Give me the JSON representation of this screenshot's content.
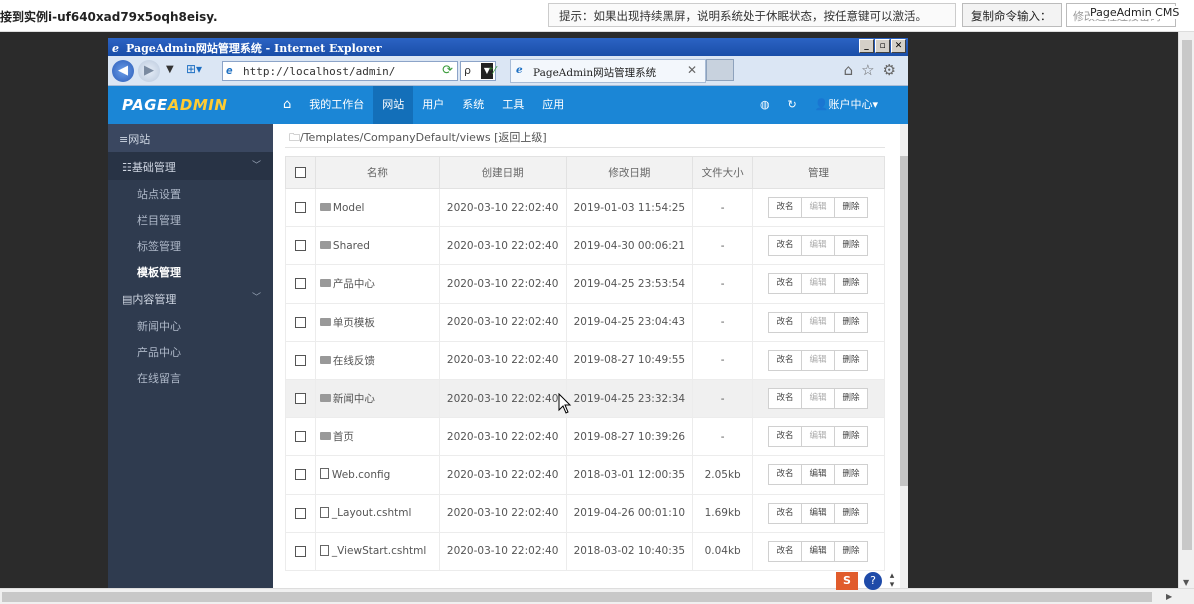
{
  "remote": {
    "title": "接到实例i-uf640xad79x5oqh8eisy.",
    "hint": "提示：如果出现持续黑屏，说明系统处于休眠状态，按任意键可以激活。",
    "copy_label": "复制命令输入：",
    "input_placeholder": "修改远程连接密码",
    "badge": "PageAdmin CMS"
  },
  "ie": {
    "window_title": "PageAdmin网站管理系统 - Internet Explorer",
    "address": "http://localhost/admin/",
    "tab_title": "PageAdmin网站管理系统",
    "search_label": "ρ"
  },
  "app": {
    "logo_main": "PAGE",
    "logo_accent": "ADMIN",
    "nav": [
      "我的工作台",
      "网站",
      "用户",
      "系统",
      "工具",
      "应用"
    ],
    "nav_active_index": 1,
    "account_label": "账户中心"
  },
  "sidebar": {
    "header": "网站",
    "groups": [
      {
        "label": "基础管理",
        "icon": "grid-icon",
        "items": [
          "站点设置",
          "栏目管理",
          "标签管理",
          "模板管理"
        ],
        "active": "模板管理"
      },
      {
        "label": "内容管理",
        "icon": "document-icon",
        "items": [
          "新闻中心",
          "产品中心",
          "在线留言"
        ]
      }
    ]
  },
  "content": {
    "path": "/Templates/CompanyDefault/views",
    "back_label": "[返回上级]",
    "columns": [
      "名称",
      "创建日期",
      "修改日期",
      "文件大小",
      "管理"
    ],
    "rows": [
      {
        "type": "folder",
        "name": "Model",
        "created": "2020-03-10 22:02:40",
        "modified": "2019-01-03 11:54:25",
        "size": "-",
        "editable": false
      },
      {
        "type": "folder",
        "name": "Shared",
        "created": "2020-03-10 22:02:40",
        "modified": "2019-04-30 00:06:21",
        "size": "-",
        "editable": false
      },
      {
        "type": "folder",
        "name": "产品中心",
        "created": "2020-03-10 22:02:40",
        "modified": "2019-04-25 23:53:54",
        "size": "-",
        "editable": false
      },
      {
        "type": "folder",
        "name": "单页模板",
        "created": "2020-03-10 22:02:40",
        "modified": "2019-04-25 23:04:43",
        "size": "-",
        "editable": false
      },
      {
        "type": "folder",
        "name": "在线反馈",
        "created": "2020-03-10 22:02:40",
        "modified": "2019-08-27 10:49:55",
        "size": "-",
        "editable": false
      },
      {
        "type": "folder",
        "name": "新闻中心",
        "created": "2020-03-10 22:02:40",
        "modified": "2019-04-25 23:32:34",
        "size": "-",
        "editable": false,
        "highlighted": true
      },
      {
        "type": "folder",
        "name": "首页",
        "created": "2020-03-10 22:02:40",
        "modified": "2019-08-27 10:39:26",
        "size": "-",
        "editable": false
      },
      {
        "type": "file",
        "name": "Web.config",
        "created": "2020-03-10 22:02:40",
        "modified": "2018-03-01 12:00:35",
        "size": "2.05kb",
        "editable": true
      },
      {
        "type": "file",
        "name": "_Layout.cshtml",
        "created": "2020-03-10 22:02:40",
        "modified": "2019-04-26 00:01:10",
        "size": "1.69kb",
        "editable": true
      },
      {
        "type": "file",
        "name": "_ViewStart.cshtml",
        "created": "2020-03-10 22:02:40",
        "modified": "2018-03-02 10:40:35",
        "size": "0.04kb",
        "editable": true
      }
    ],
    "ops": {
      "rename": "改名",
      "edit": "编辑",
      "delete": "删除"
    }
  },
  "colors": {
    "header": "#1b86d6",
    "sidebar": "#2f3b4f",
    "logo_accent": "#ffcc33"
  }
}
